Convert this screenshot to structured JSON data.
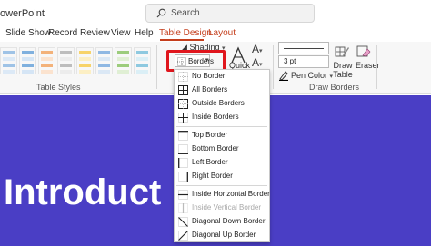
{
  "app": {
    "title": "owerPoint"
  },
  "search": {
    "placeholder": "Search"
  },
  "tabs": [
    {
      "label": "Slide Show"
    },
    {
      "label": "Record"
    },
    {
      "label": "Review"
    },
    {
      "label": "View"
    },
    {
      "label": "Help"
    },
    {
      "label": "Table Design",
      "active": true
    },
    {
      "label": "Layout"
    }
  ],
  "ribbon": {
    "table_styles_label": "Table Styles",
    "shading_label": "Shading",
    "borders_label": "Borders",
    "quick_label": "Quick",
    "line_weight": "3 pt",
    "pen_color_label": "Pen Color",
    "draw_table_label": "Draw Table",
    "eraser_label": "Eraser",
    "draw_borders_label": "Draw Borders",
    "accent_color": "#c43e1c",
    "highlight_color": "#e0161d"
  },
  "slide": {
    "title": "Introduct",
    "background": "#4a3ec5"
  },
  "borders_menu": {
    "items": [
      {
        "label": "No Border",
        "icon": "no-border-icon"
      },
      {
        "label": "All Borders",
        "icon": "all-borders-icon"
      },
      {
        "label": "Outside Borders",
        "icon": "outside-borders-icon"
      },
      {
        "label": "Inside Borders",
        "icon": "inside-borders-icon"
      },
      {
        "label": "Top Border",
        "icon": "top-border-icon"
      },
      {
        "label": "Bottom Border",
        "icon": "bottom-border-icon"
      },
      {
        "label": "Left Border",
        "icon": "left-border-icon"
      },
      {
        "label": "Right Border",
        "icon": "right-border-icon"
      },
      {
        "label": "Inside Horizontal Border",
        "icon": "inside-horizontal-border-icon"
      },
      {
        "label": "Inside Vertical Border",
        "icon": "inside-vertical-border-icon",
        "disabled": true
      },
      {
        "label": "Diagonal Down Border",
        "icon": "diagonal-down-border-icon"
      },
      {
        "label": "Diagonal Up Border",
        "icon": "diagonal-up-border-icon"
      }
    ]
  }
}
